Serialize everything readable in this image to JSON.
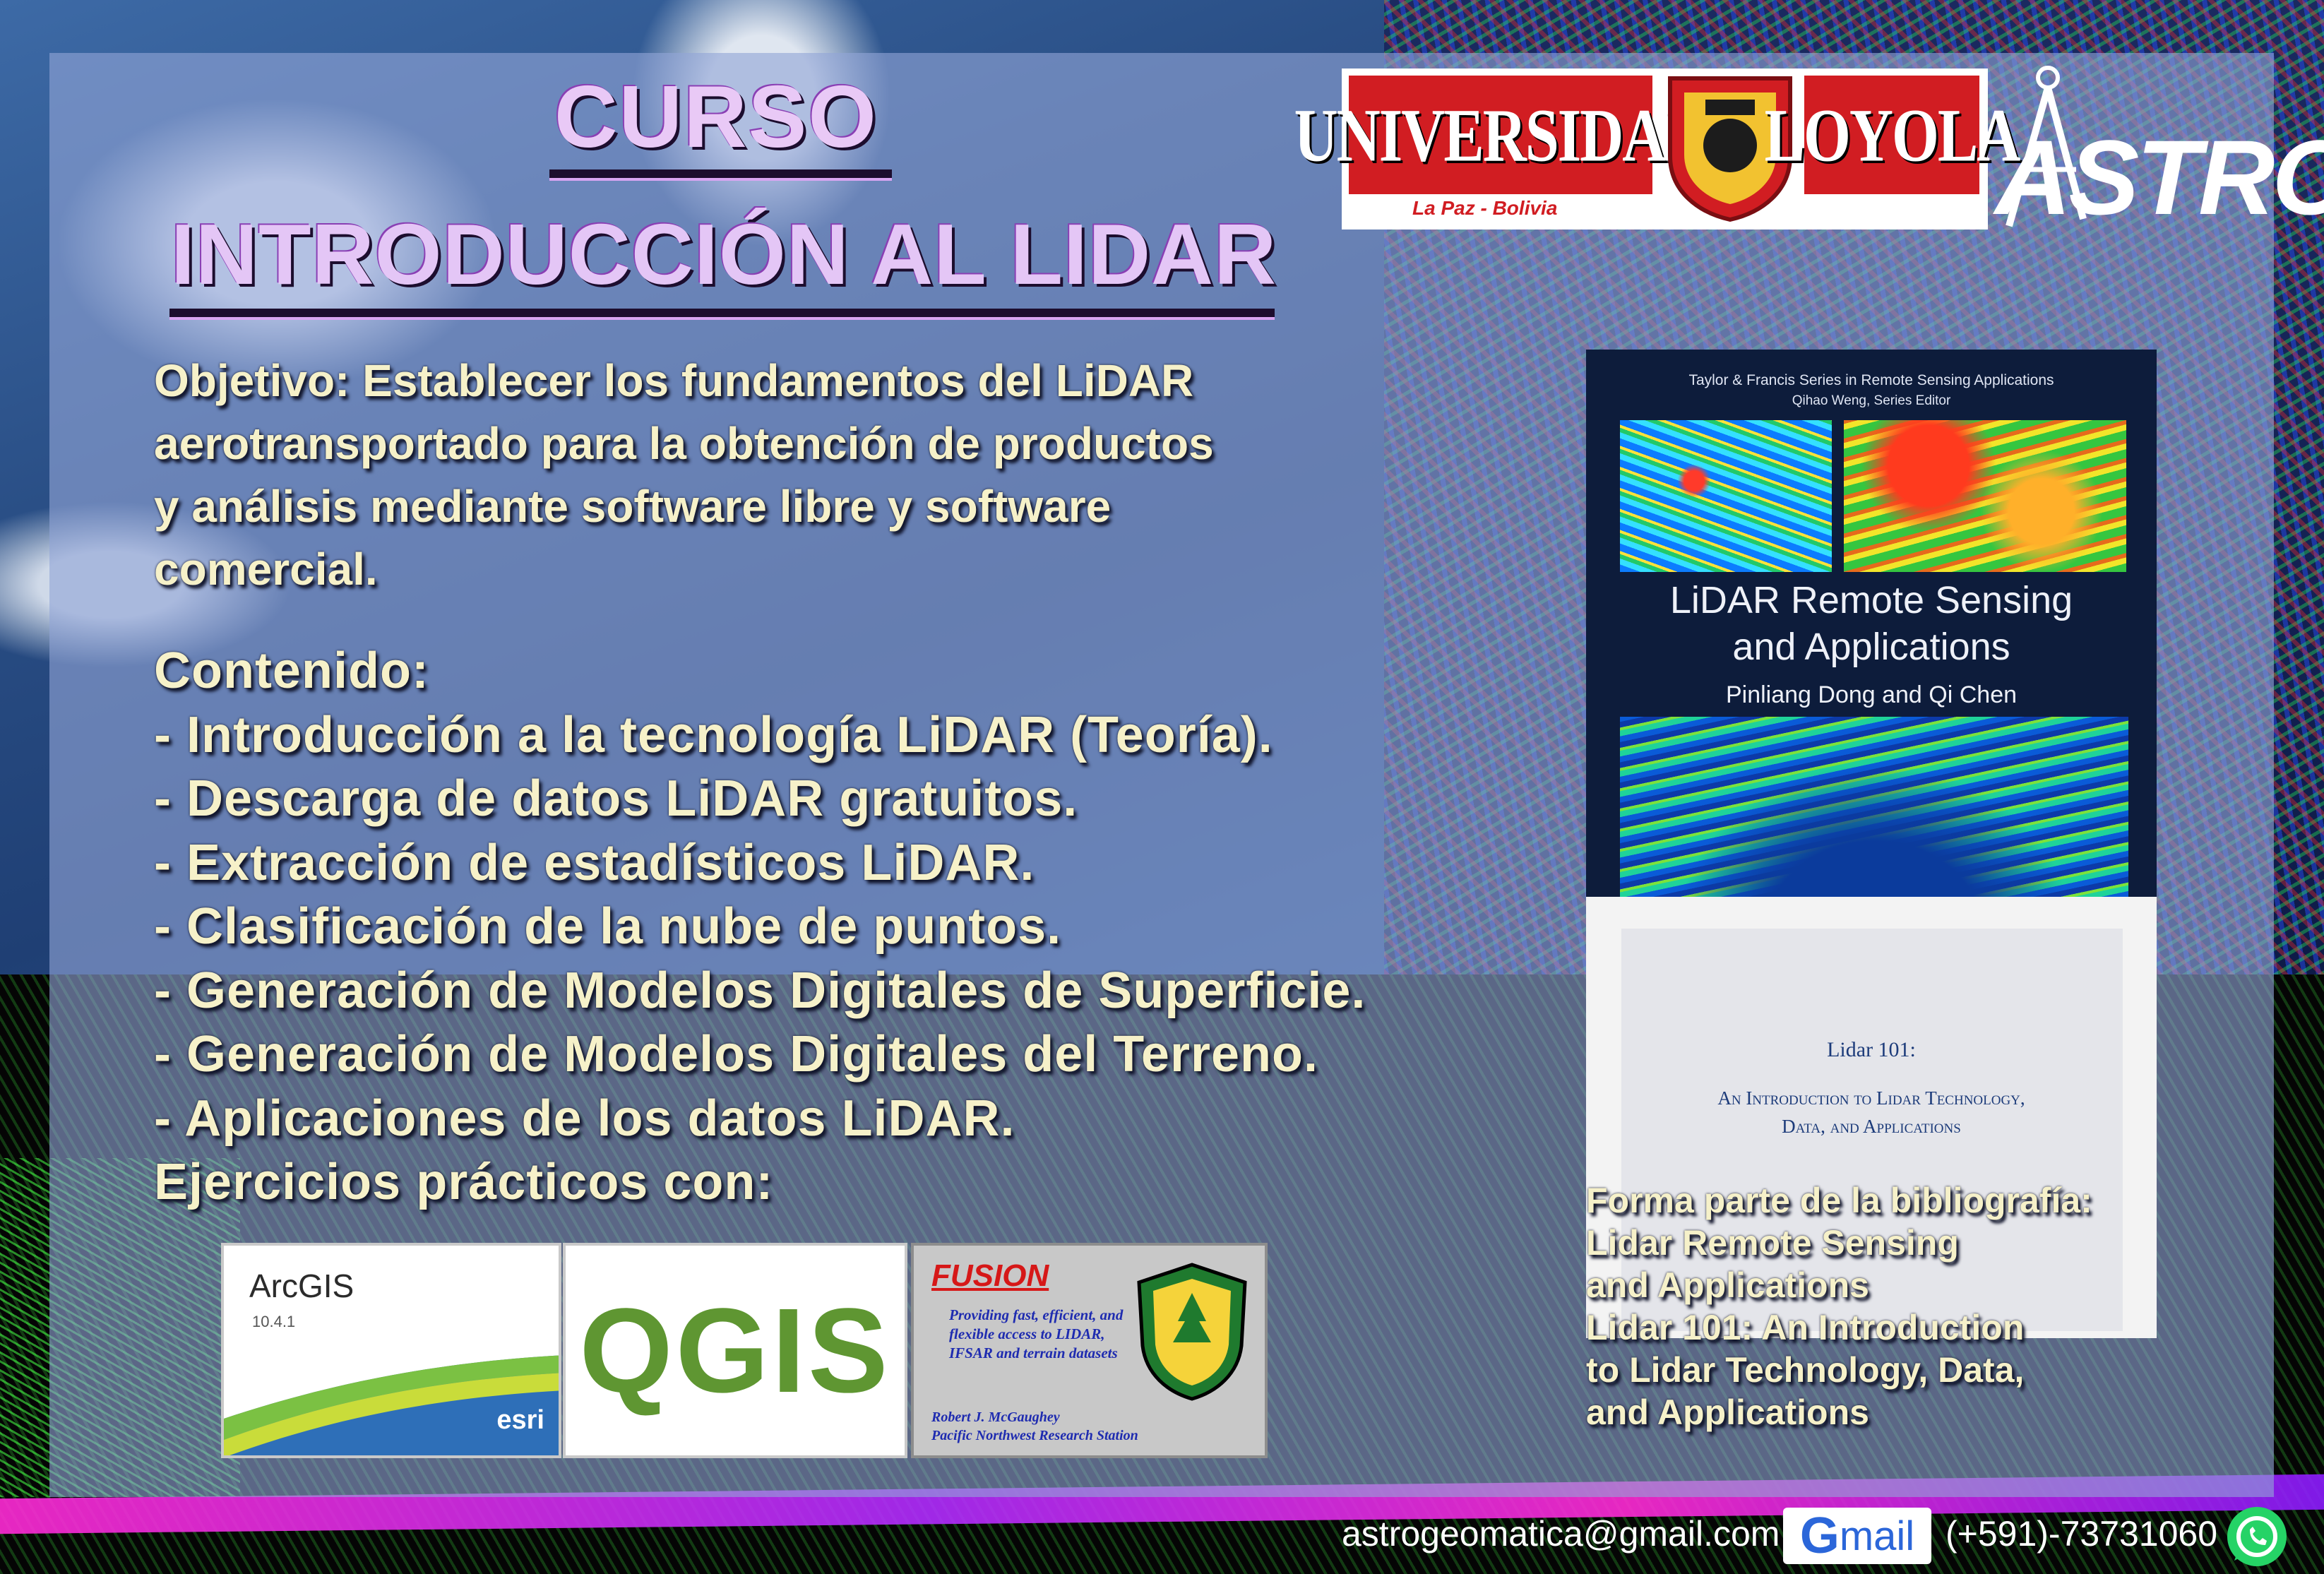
{
  "heading": {
    "course_label": "CURSO",
    "course_title": "INTRODUCCIÓN AL LIDAR"
  },
  "objective": {
    "lines": [
      "Objetivo: Establecer los fundamentos del LiDAR",
      "aerotransportado para la obtención de productos",
      "y análisis mediante software libre y software",
      "comercial."
    ]
  },
  "contents": {
    "heading": "Contenido:",
    "items": [
      "- Introducción a la tecnología LiDAR (Teoría).",
      "- Descarga de datos LiDAR gratuitos.",
      "- Extracción de estadísticos LiDAR.",
      "- Clasificación de la nube de puntos.",
      "- Generación de Modelos Digitales de Superficie.",
      "- Generación de Modelos Digitales del Terreno.",
      "- Aplicaciones de los datos LiDAR."
    ],
    "exercises_label": "Ejercicios prácticos con:"
  },
  "software_logos": {
    "arcgis_name": "ArcGIS",
    "arcgis_version": "10.4.1",
    "arcgis_esri": "esri",
    "qgis_name": "QGIS",
    "fusion_title": "FUSION",
    "fusion_desc": "Providing fast, efficient, and flexible access to LIDAR, IFSAR and terrain datasets",
    "fusion_author_1": "Robert J. McGaughey",
    "fusion_author_2": "Pacific Northwest Research Station"
  },
  "university": {
    "word_left": "UNIVERSIDAD",
    "word_right": "LOYOLA",
    "location": "La Paz - Bolivia",
    "crest_icon": "shield-crest-icon"
  },
  "astro": {
    "name": "ASTRO",
    "icon": "compass-icon"
  },
  "book1": {
    "series": "Taylor & Francis Series in Remote Sensing Applications",
    "editor": "Qihao Weng, Series Editor",
    "title_line1": "LiDAR Remote Sensing",
    "title_line2": "and Applications",
    "authors": "Pinliang Dong and Qi Chen"
  },
  "book2": {
    "title": "Lidar 101:",
    "subtitle_line1": "An Introduction to Lidar Technology,",
    "subtitle_line2": "Data, and Applications"
  },
  "bibliography": {
    "lines": [
      "Forma parte de la bibliografía:",
      "Lidar Remote Sensing",
      "and Applications",
      "Lidar 101: An Introduction",
      "to Lidar Technology, Data,",
      "and Applications"
    ]
  },
  "footer": {
    "email": "astrogeomatica@gmail.com",
    "gmail_g": "G",
    "gmail_rest": "mail",
    "phone": "(+591)-73731060",
    "whatsapp_icon": "whatsapp-icon"
  },
  "colors": {
    "title_text": "#e4c6f6",
    "body_text": "#f6f1c9",
    "university_red": "#d11d22",
    "qgis_green": "#5f9632",
    "fusion_red": "#d61818"
  }
}
